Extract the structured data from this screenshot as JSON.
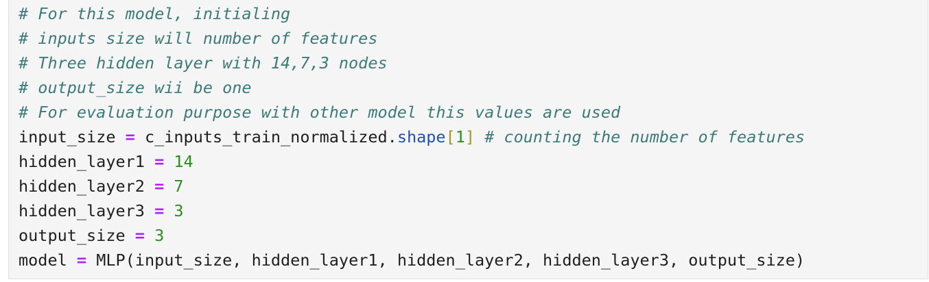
{
  "cell": {
    "lines": [
      {
        "comment": "# For this model, initialing"
      },
      {
        "comment": "# inputs size will number of features"
      },
      {
        "comment": "# Three hidden layer with 14,7,3 nodes"
      },
      {
        "comment": "# output_size wii be one"
      },
      {
        "comment": "# For evaluation purpose with other model this values are used"
      },
      {
        "var": "input_size",
        "op": "=",
        "obj": "c_inputs_train_normalized.",
        "attr": "shape",
        "bracket_open": "[",
        "index": "1",
        "bracket_close": "]",
        "comment": "# counting the number of features"
      },
      {
        "var": "hidden_layer1",
        "op": "=",
        "value": "14"
      },
      {
        "var": "hidden_layer2",
        "op": "=",
        "value": "7"
      },
      {
        "var": "hidden_layer3",
        "op": "=",
        "value": "3"
      },
      {
        "var": "output_size",
        "op": "=",
        "value": "3"
      },
      {
        "var": "model",
        "op": "=",
        "call": "MLP(input_size, hidden_layer1, hidden_layer2, hidden_layer3, output_size)"
      }
    ]
  },
  "colors": {
    "comment": "#3d7a7a",
    "operator": "#aa22ff",
    "number": "#2e8b1f",
    "attribute": "#1f52b0",
    "bracket": "#9a9a2a",
    "cell_background": "#f5f5f5"
  }
}
